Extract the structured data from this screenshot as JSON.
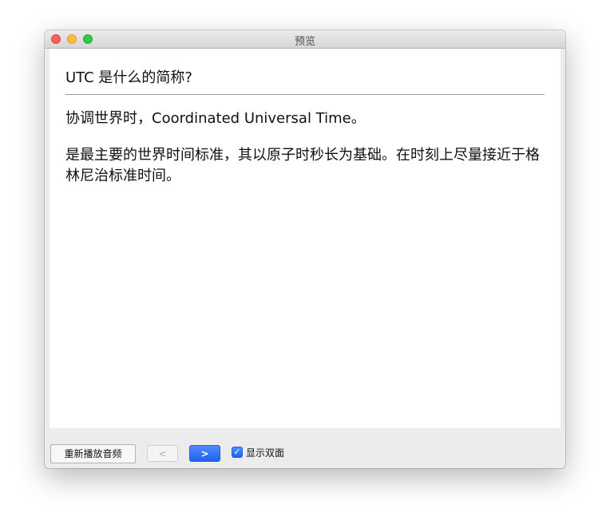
{
  "window": {
    "title": "预览"
  },
  "card": {
    "question": "UTC 是什么的简称?",
    "answer_line1": "协调世界时，Coordinated Universal Time。",
    "answer_line2": "是最主要的世界时间标准，其以原子时秒长为基础。在时刻上尽量接近于格林尼治标准时间。"
  },
  "toolbar": {
    "replay_label": "重新播放音频",
    "prev_label": "<",
    "next_label": ">",
    "show_both_sides_label": "显示双面",
    "show_both_sides_checked": true
  },
  "icons": {
    "checkbox": "checkmark-icon"
  },
  "colors": {
    "accent": "#1f61f2",
    "close": "#fc605c",
    "minimize": "#fdbc40",
    "maximize": "#34c84a"
  }
}
